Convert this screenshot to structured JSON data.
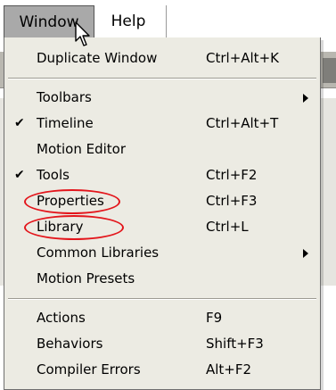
{
  "menubar": {
    "items": [
      {
        "label": "Window"
      },
      {
        "label": "Help"
      }
    ]
  },
  "menu": {
    "items": [
      {
        "label": "Duplicate Window",
        "shortcut": "Ctrl+Alt+K",
        "checked": false,
        "submenu": false
      },
      {
        "label": "Toolbars",
        "shortcut": "",
        "checked": false,
        "submenu": true
      },
      {
        "label": "Timeline",
        "shortcut": "Ctrl+Alt+T",
        "checked": true,
        "submenu": false
      },
      {
        "label": "Motion Editor",
        "shortcut": "",
        "checked": false,
        "submenu": false
      },
      {
        "label": "Tools",
        "shortcut": "Ctrl+F2",
        "checked": true,
        "submenu": false
      },
      {
        "label": "Properties",
        "shortcut": "Ctrl+F3",
        "checked": false,
        "submenu": false,
        "highlighted": true
      },
      {
        "label": "Library",
        "shortcut": "Ctrl+L",
        "checked": false,
        "submenu": false,
        "highlighted": true
      },
      {
        "label": "Common Libraries",
        "shortcut": "",
        "checked": false,
        "submenu": true
      },
      {
        "label": "Motion Presets",
        "shortcut": "",
        "checked": false,
        "submenu": false
      },
      {
        "label": "Actions",
        "shortcut": "F9",
        "checked": false,
        "submenu": false
      },
      {
        "label": "Behaviors",
        "shortcut": "Shift+F3",
        "checked": false,
        "submenu": false
      },
      {
        "label": "Compiler Errors",
        "shortcut": "Alt+F2",
        "checked": false,
        "submenu": false
      }
    ],
    "check_mark": "✔",
    "highlight_color": "#e3161c"
  },
  "icons": {
    "cursor": "mouse-pointer-icon",
    "submenu": "submenu-arrow-icon",
    "check": "check-icon"
  }
}
